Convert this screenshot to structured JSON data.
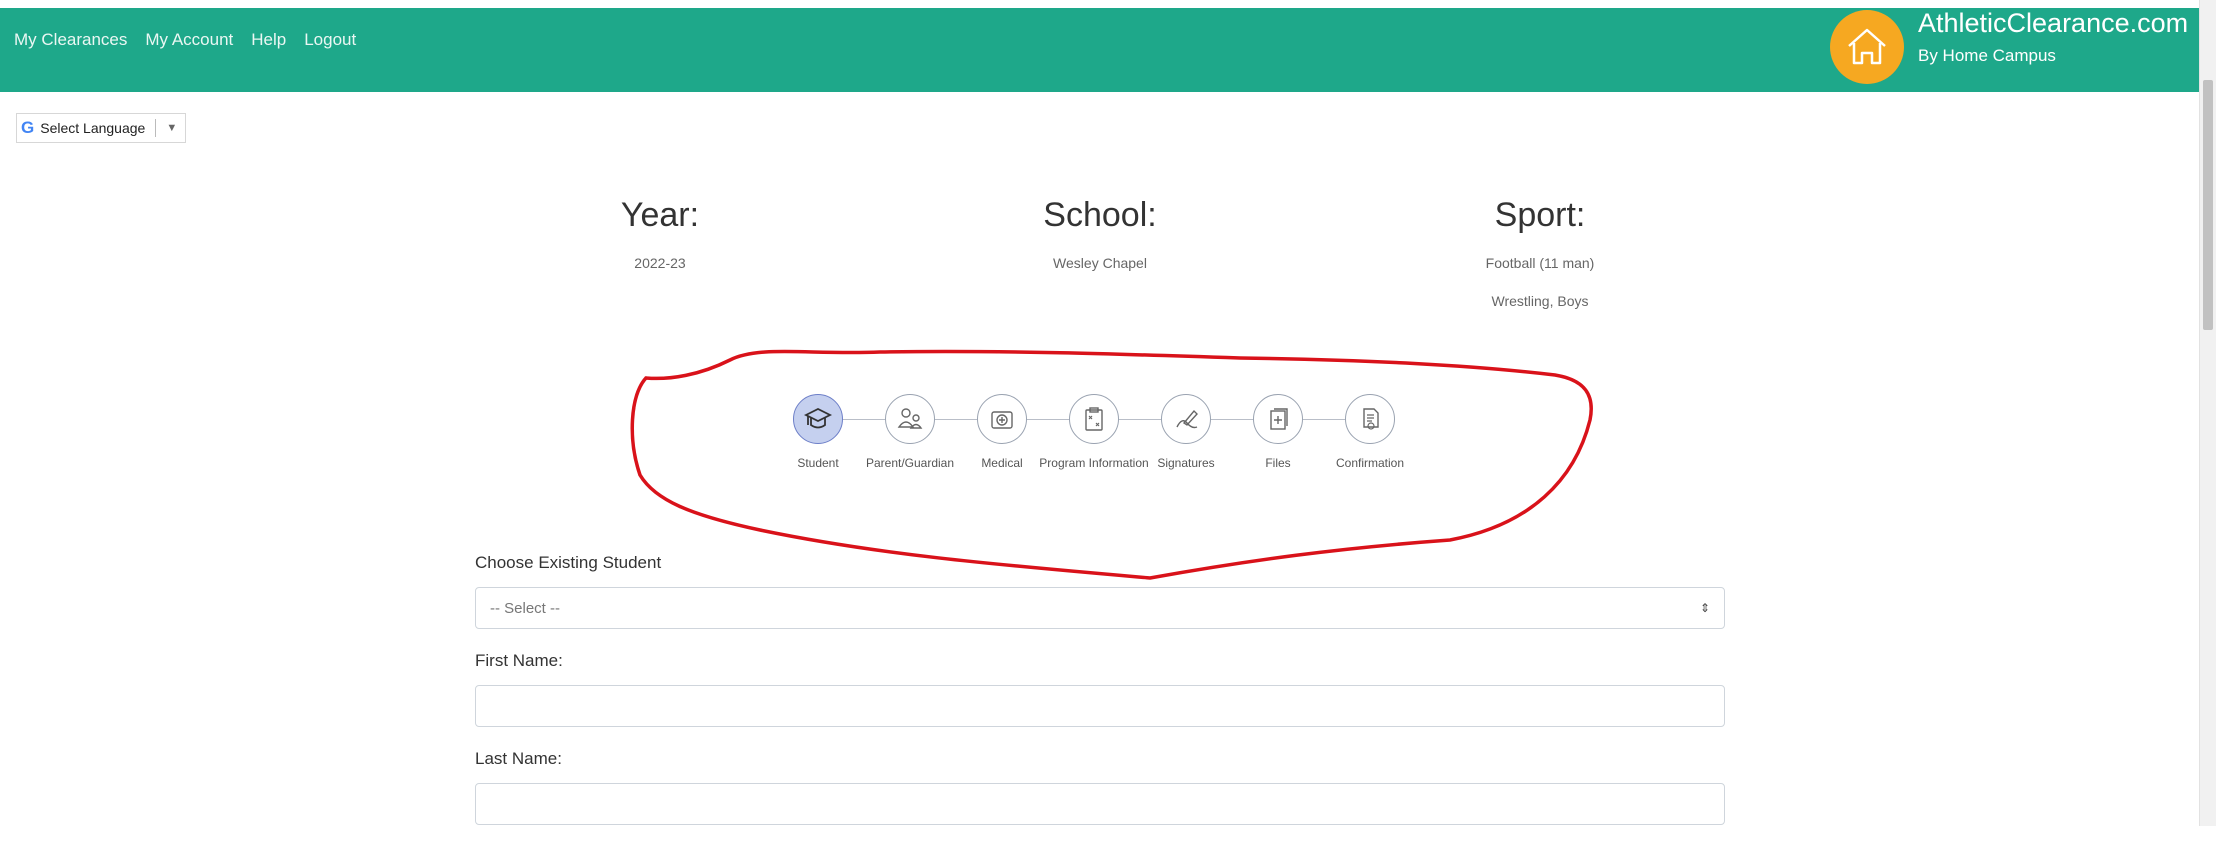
{
  "nav": [
    "My Clearances",
    "My Account",
    "Help",
    "Logout"
  ],
  "brand": {
    "title": "AthleticClearance.com",
    "subtitle": "By Home Campus"
  },
  "translate": {
    "label": "Select Language"
  },
  "info": {
    "year": {
      "heading": "Year:",
      "value": "2022-23"
    },
    "school": {
      "heading": "School:",
      "value": "Wesley Chapel"
    },
    "sport": {
      "heading": "Sport:",
      "values": [
        "Football (11 man)",
        "Wrestling, Boys"
      ]
    }
  },
  "steps": [
    {
      "label": "Student",
      "icon": "student-cap-icon",
      "active": true
    },
    {
      "label": "Parent/Guardian",
      "icon": "parent-icon",
      "active": false
    },
    {
      "label": "Medical",
      "icon": "medical-kit-icon",
      "active": false
    },
    {
      "label": "Program Information",
      "icon": "clipboard-icon",
      "active": false
    },
    {
      "label": "Signatures",
      "icon": "signature-icon",
      "active": false
    },
    {
      "label": "Files",
      "icon": "files-icon",
      "active": false
    },
    {
      "label": "Confirmation",
      "icon": "certificate-icon",
      "active": false
    }
  ],
  "form": {
    "existing_label": "Choose Existing Student",
    "existing_value": "-- Select --",
    "first_label": "First Name:",
    "first_value": "",
    "last_label": "Last Name:",
    "last_value": ""
  },
  "colors": {
    "header": "#1ea88a",
    "logo": "#f6a821",
    "annotation": "#d9121a",
    "active_step": "#c5d0ef"
  }
}
